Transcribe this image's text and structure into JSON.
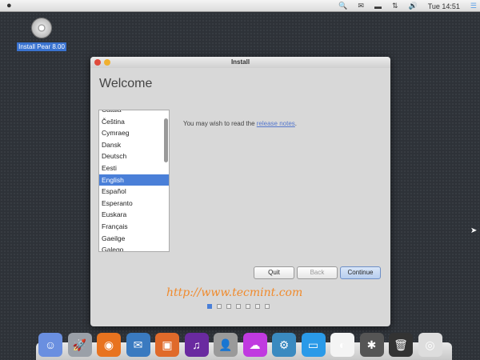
{
  "menubar": {
    "clock": "Tue 14:51",
    "tray_icons": [
      "search-icon",
      "mail-icon",
      "battery-icon",
      "network-icon",
      "volume-icon"
    ]
  },
  "desktop": {
    "icon_label": "Install Pear 8.00"
  },
  "window": {
    "title": "Install",
    "heading": "Welcome",
    "languages": [
      "Català",
      "Čeština",
      "Cymraeg",
      "Dansk",
      "Deutsch",
      "Eesti",
      "English",
      "Español",
      "Esperanto",
      "Euskara",
      "Français",
      "Gaeilge",
      "Galego"
    ],
    "selected_language": "English",
    "message_prefix": "You may wish to read the ",
    "message_link": "release notes",
    "message_suffix": ".",
    "buttons": {
      "quit": "Quit",
      "back": "Back",
      "continue": "Continue"
    },
    "watermark": "http://www.tecmint.com",
    "steps_total": 7,
    "step_current": 1
  },
  "dock": [
    {
      "name": "finder",
      "color": "#6a8fe0",
      "glyph": "☺"
    },
    {
      "name": "launchpad",
      "color": "#9aa0a8",
      "glyph": "🚀"
    },
    {
      "name": "firefox",
      "color": "#e8731f",
      "glyph": "◉"
    },
    {
      "name": "thunderbird",
      "color": "#3a7ac0",
      "glyph": "✉"
    },
    {
      "name": "photos",
      "color": "#e06a2a",
      "glyph": "▣"
    },
    {
      "name": "itunes",
      "color": "#6a2aa0",
      "glyph": "♫"
    },
    {
      "name": "contacts",
      "color": "#9a9a9a",
      "glyph": "👤"
    },
    {
      "name": "icloud",
      "color": "#c03ae0",
      "glyph": "☁"
    },
    {
      "name": "software-center",
      "color": "#3a8ac0",
      "glyph": "⚙"
    },
    {
      "name": "system-display",
      "color": "#2a9ae8",
      "glyph": "▭"
    },
    {
      "name": "settings-toggle",
      "color": "#f4f4f4",
      "glyph": "◐"
    },
    {
      "name": "system-tool",
      "color": "#555",
      "glyph": "✱"
    },
    {
      "name": "trash",
      "color": "#333",
      "glyph": "🗑"
    },
    {
      "name": "install-disc",
      "color": "#ddd",
      "glyph": "◎"
    }
  ]
}
